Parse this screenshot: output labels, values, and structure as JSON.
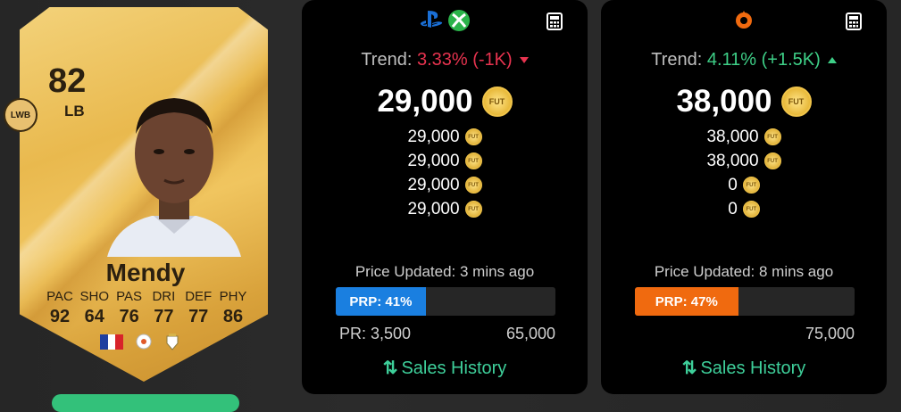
{
  "card": {
    "rating": "82",
    "position": "LB",
    "alt_position": "LWB",
    "name": "Mendy",
    "stat_labels": [
      "PAC",
      "SHO",
      "PAS",
      "DRI",
      "DEF",
      "PHY"
    ],
    "stat_values": [
      "92",
      "64",
      "76",
      "77",
      "77",
      "86"
    ],
    "nation_icon": "france-flag-icon",
    "league_icon": "laliga-icon",
    "club_icon": "real-madrid-crest-icon",
    "card_color": "#e9b94e"
  },
  "console_panel": {
    "platform_icons": [
      "playstation-icon",
      "xbox-icon"
    ],
    "trend_label": "Trend:",
    "trend_value": "3.33% (-1K)",
    "trend_direction": "down",
    "main_price": "29,000",
    "coin_label": "FUT",
    "prices": [
      "29,000",
      "29,000",
      "29,000",
      "29,000"
    ],
    "updated": "Price Updated: 3 mins ago",
    "prp_label": "PRP: 41%",
    "prp_percent": 41,
    "range_min": "PR: 3,500",
    "range_max": "65,000",
    "sales_label": "Sales History",
    "accent": "#1a7fe0"
  },
  "pc_panel": {
    "platform_icons": [
      "origin-icon"
    ],
    "trend_label": "Trend:",
    "trend_value": "4.11% (+1.5K)",
    "trend_direction": "up",
    "main_price": "38,000",
    "coin_label": "FUT",
    "prices": [
      "38,000",
      "38,000",
      "0",
      "0"
    ],
    "updated": "Price Updated: 8 mins ago",
    "prp_label": "PRP: 47%",
    "prp_percent": 47,
    "range_min": "",
    "range_max": "75,000",
    "sales_label": "Sales History",
    "accent": "#f06a0f"
  },
  "colors": {
    "trend_down": "#e7334f",
    "trend_up": "#3ecf87",
    "sales": "#3ecf9a"
  }
}
